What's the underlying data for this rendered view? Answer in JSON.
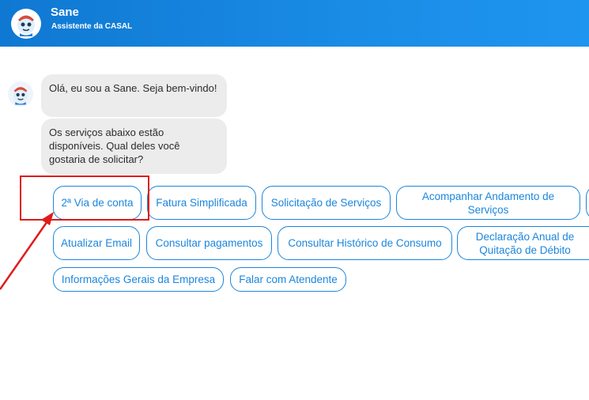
{
  "header": {
    "title": "Sane",
    "subtitle": "Assistente da CASAL",
    "background_color": "#1a8ce6",
    "avatar_icon": "sane-mascot-icon"
  },
  "chat": {
    "messages": [
      {
        "from": "bot",
        "text": "Olá, eu sou a Sane. Seja bem-vindo!"
      },
      {
        "from": "bot",
        "text": "Os serviços abaixo estão disponíveis. Qual deles você gostaria de solicitar?"
      }
    ],
    "options": [
      "2ª Via de conta",
      "Fatura Simplificada",
      "Solicitação de Serviços",
      "Acompanhar Andamento de Serviços",
      "",
      "Atualizar Email",
      "Consultar pagamentos",
      "Consultar Histórico de Consumo",
      "Declaração Anual de Quitação de Débito",
      "Informações Gerais da Empresa",
      "Falar com Atendente"
    ],
    "option_color": "#1b86dd"
  },
  "annotation": {
    "color": "#e01b1b",
    "target": "2ª Via de conta"
  }
}
